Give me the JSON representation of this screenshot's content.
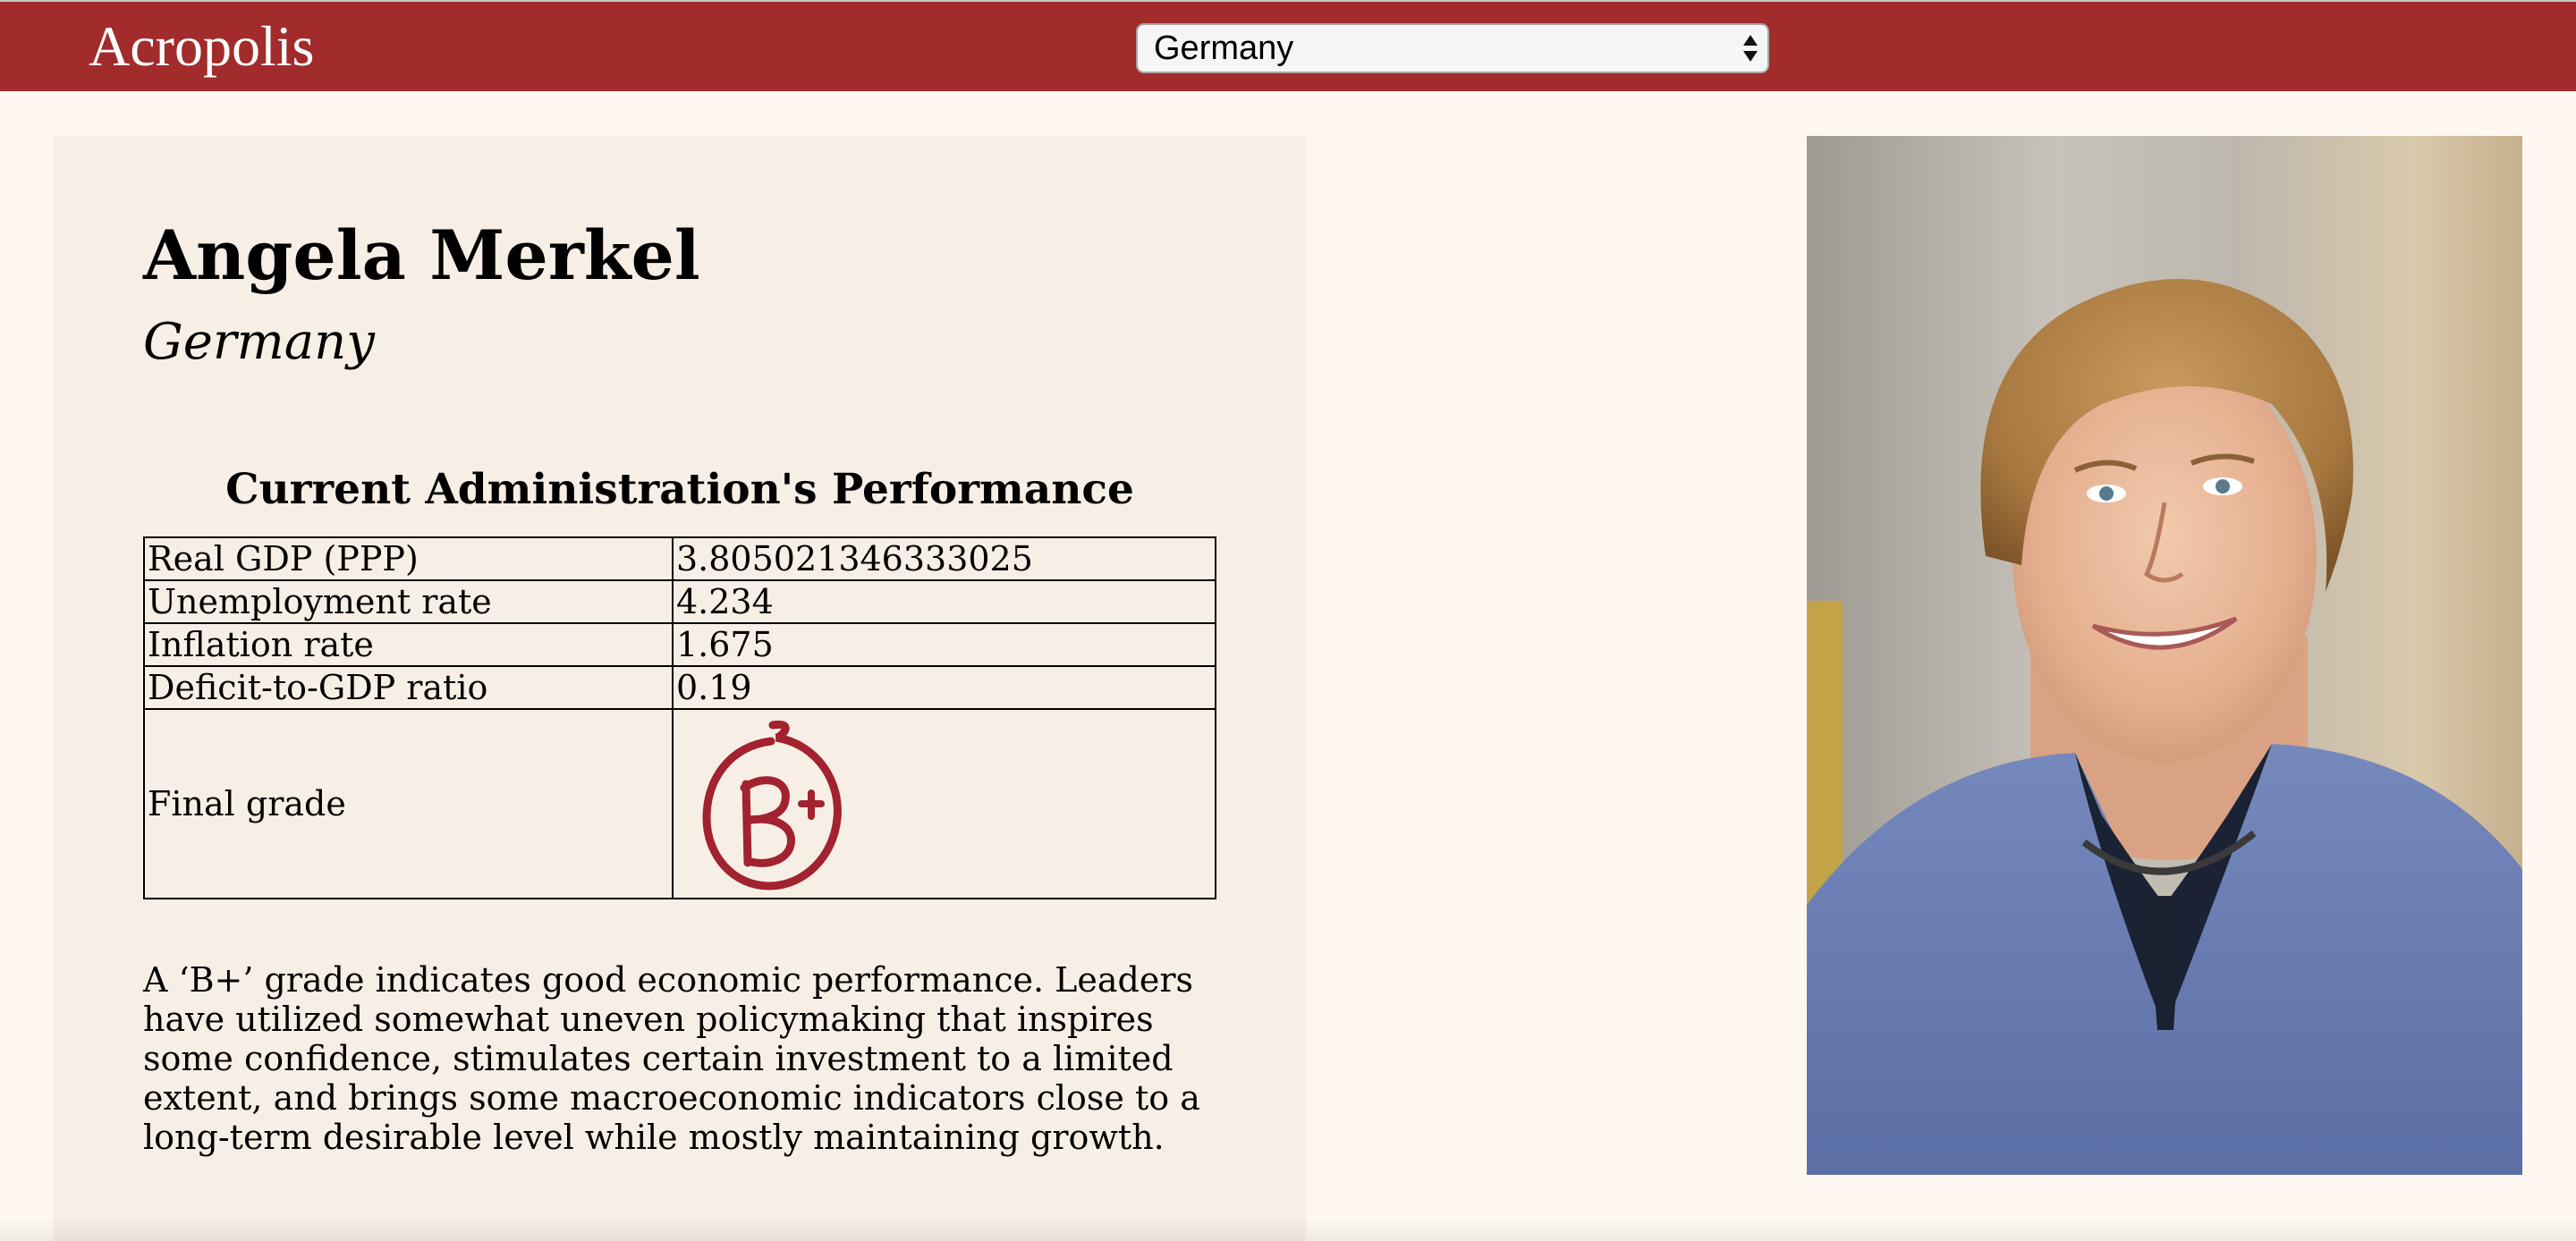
{
  "header": {
    "brand": "Acropolis",
    "country_select": {
      "selected": "Germany"
    }
  },
  "profile": {
    "name": "Angela Merkel",
    "country": "Germany"
  },
  "performance": {
    "title": "Current Administration's Performance",
    "rows": [
      {
        "label": "Real GDP (PPP)",
        "value": "3.805021346333025"
      },
      {
        "label": "Unemployment rate",
        "value": "4.234"
      },
      {
        "label": "Inflation rate",
        "value": "1.675"
      },
      {
        "label": "Deficit-to-GDP ratio",
        "value": "0.19"
      }
    ],
    "final_grade_label": "Final grade",
    "final_grade": "B+",
    "grade_color": "#a2222f"
  },
  "description": "A ‘B+’ grade indicates good economic performance. Leaders have utilized somewhat uneven policymaking that inspires some confidence, stimulates certain investment to a limited extent, and brings some macroeconomic indicators close to a long-term desirable level while mostly maintaining growth.",
  "colors": {
    "header_bg": "#a12c2b",
    "page_bg": "#fef8f1",
    "card_bg": "#f7efe6"
  }
}
